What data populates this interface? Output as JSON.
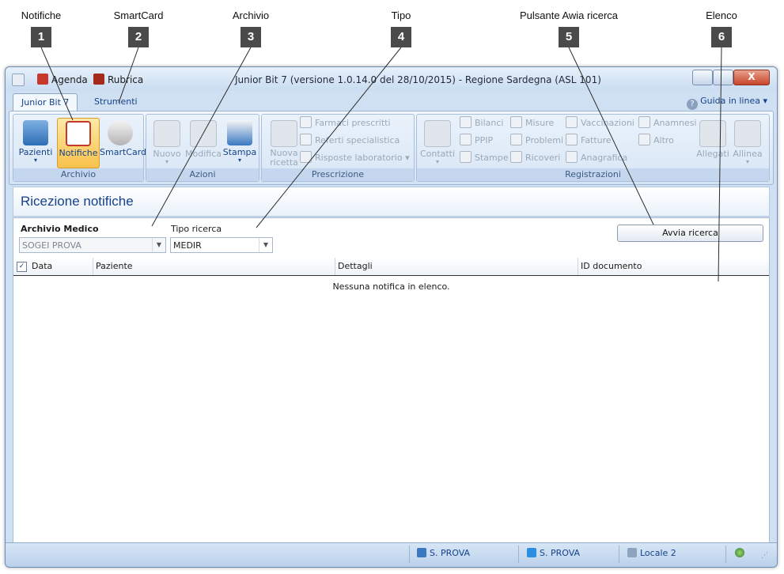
{
  "callouts": [
    {
      "label": "Notifiche",
      "number": "1"
    },
    {
      "label": "SmartCard",
      "number": "2"
    },
    {
      "label": "Archivio",
      "number": "3"
    },
    {
      "label": "Tipo",
      "number": "4"
    },
    {
      "label": "Pulsante Awia ricerca",
      "number": "5"
    },
    {
      "label": "Elenco",
      "number": "6"
    }
  ],
  "titlebar": {
    "agenda": "Agenda",
    "rubrica": "Rubrica",
    "title": "Junior Bit 7 (versione 1.0.14.0 del 28/10/2015) - Regione Sardegna (ASL 101)",
    "close": "X"
  },
  "tabs": [
    "Junior Bit 7",
    "Strumenti"
  ],
  "help": {
    "label": "Guida in linea",
    "arrow": "▾"
  },
  "ribbon": {
    "archivio": {
      "label": "Archivio",
      "pazienti": "Pazienti",
      "notifiche": "Notifiche",
      "smartcard": "SmartCard"
    },
    "azioni": {
      "label": "Azioni",
      "nuovo": "Nuovo",
      "modifica": "Modifica",
      "stampa": "Stampa"
    },
    "prescrizione": {
      "label": "Prescrizione",
      "nuova_ricetta_1": "Nuova",
      "nuova_ricetta_2": "ricetta",
      "farmaci": "Farmaci prescritti",
      "referti": "Referti specialistica",
      "risposte": "Risposte laboratorio"
    },
    "registrazioni": {
      "label": "Registrazioni",
      "contatti": "Contatti",
      "bilanci": "Bilanci",
      "ppip": "PPIP",
      "stampe": "Stampe",
      "misure": "Misure",
      "problemi": "Problemi",
      "ricoveri": "Ricoveri",
      "vaccinazioni": "Vaccinazioni",
      "fatture": "Fatture",
      "anagrafica": "Anagrafica",
      "anamnesi": "Anamnesi",
      "altro": "Altro",
      "allegati": "Allegati",
      "allinea": "Allinea"
    }
  },
  "page": {
    "title": "Ricezione notifiche"
  },
  "form": {
    "archivio_label": "Archivio Medico",
    "archivio_value": "SOGEI PROVA",
    "tipo_label": "Tipo ricerca",
    "tipo_value": "MEDIR",
    "avvia_label": "Avvia ricerca"
  },
  "grid": {
    "check_glyph": "✓",
    "columns": [
      "Data",
      "Paziente",
      "Dettagli",
      "ID documento"
    ],
    "empty_message": "Nessuna notifica in elenco."
  },
  "status": {
    "user": "S. PROVA",
    "db": "S. PROVA",
    "location": "Locale 2"
  },
  "colors": {
    "accent": "#15428b",
    "selected": "#f8c24c",
    "callout_box": "#4a4a4a"
  }
}
